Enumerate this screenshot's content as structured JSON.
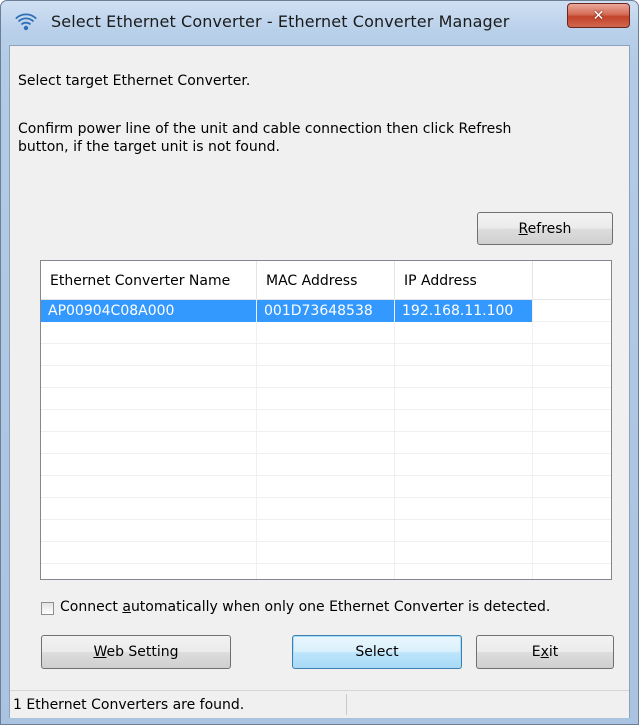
{
  "window": {
    "title": "Select Ethernet Converter - Ethernet Converter Manager",
    "icon": "wifi-icon",
    "close_glyph": "✕"
  },
  "instructions": {
    "line1": "Select target Ethernet Converter.",
    "line2": "Confirm power line of the unit and cable connection then click Refresh",
    "line3": "button, if the target unit is not found."
  },
  "buttons": {
    "refresh": {
      "pre": "",
      "ul": "R",
      "post": "efresh"
    },
    "web_setting": {
      "pre": "",
      "ul": "W",
      "post": "eb Setting"
    },
    "select": "Select",
    "exit": {
      "pre": "E",
      "ul": "x",
      "post": "it"
    }
  },
  "list": {
    "columns": [
      "Ethernet Converter Name",
      "MAC Address",
      "IP Address"
    ],
    "rows": [
      {
        "name": "AP00904C08A000",
        "mac": "001D73648538",
        "ip": "192.168.11.100",
        "selected": true
      }
    ]
  },
  "auto_connect": {
    "checked": false,
    "pre": "Connect ",
    "ul": "a",
    "post": "utomatically when only one Ethernet Converter is detected."
  },
  "status": {
    "text": "1 Ethernet Converters are found."
  },
  "colors": {
    "selection": "#3399ff",
    "dialog_bg": "#f0f0f0"
  }
}
